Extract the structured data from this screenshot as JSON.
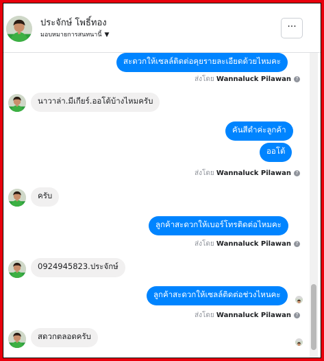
{
  "header": {
    "contact_name": "ประจักษ์ โพธิ์ทอง",
    "assign_label": "มอบหมายการสนทนานี้",
    "more_button": "···"
  },
  "messages": [
    {
      "direction": "out",
      "text": "สะดวกให้เซลล์ติดต่อคุยรายละเอียดด้วยไหมคะ"
    },
    {
      "direction": "meta",
      "prefix": "ส่งโดย",
      "sender": "Wannaluck Pilawan",
      "help": "?"
    },
    {
      "direction": "in",
      "text": "นาวาล่า.มีเกียร์.ออโต้บ้างไหมครับ"
    },
    {
      "direction": "out",
      "text": "คันสีดำค่ะลูกค้า"
    },
    {
      "direction": "out",
      "text": "ออโต้"
    },
    {
      "direction": "meta",
      "prefix": "ส่งโดย",
      "sender": "Wannaluck Pilawan",
      "help": "?"
    },
    {
      "direction": "in",
      "text": "ครับ"
    },
    {
      "direction": "out",
      "text": "ลูกค้าสะดวกให้เบอร์โทรติดต่อไหมคะ"
    },
    {
      "direction": "meta",
      "prefix": "ส่งโดย",
      "sender": "Wannaluck Pilawan",
      "help": "?"
    },
    {
      "direction": "in",
      "text": "0924945823.ประจักษ์"
    },
    {
      "direction": "out",
      "text": "ลูกค้าสะดวกให้เซลล์ติดต่อช่วงไหนคะ"
    },
    {
      "direction": "meta",
      "prefix": "ส่งโดย",
      "sender": "Wannaluck Pilawan",
      "help": "?"
    },
    {
      "direction": "in",
      "text": "สดวกตลอดครับ"
    }
  ],
  "colors": {
    "outgoing_bubble": "#0084ff",
    "incoming_bubble": "#f1f0f0",
    "frame_border": "#e8000d"
  }
}
